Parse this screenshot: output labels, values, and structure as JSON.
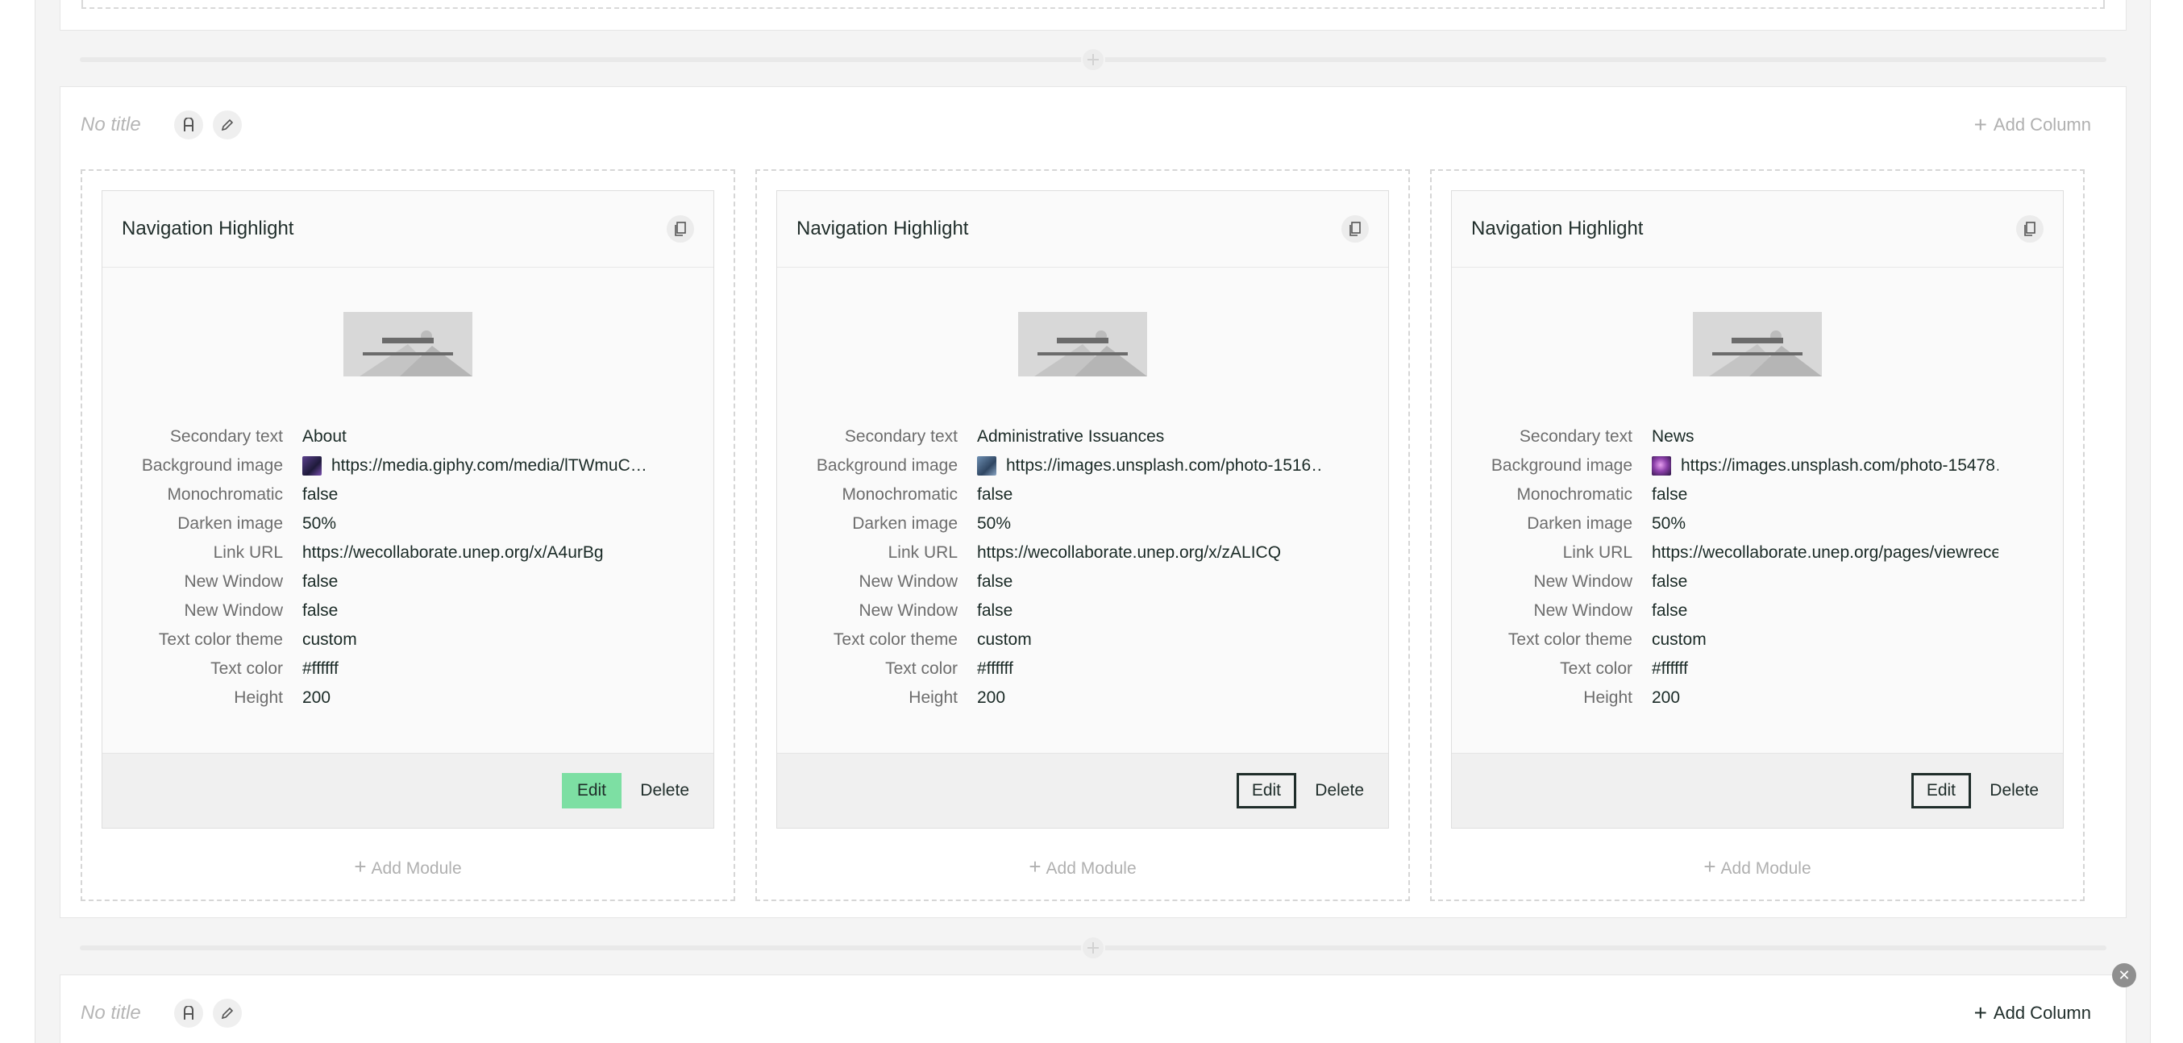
{
  "rows": [
    {
      "title": "No title",
      "add_column_label": "Add Column",
      "columns": [
        {
          "module": {
            "title": "Navigation Highlight",
            "props": [
              {
                "label": "Secondary text",
                "value": "About"
              },
              {
                "label": "Background image",
                "value": "https://media.giphy.com/media/lTWmuC…",
                "swatch": "#3b2c5e"
              },
              {
                "label": "Monochromatic",
                "value": "false"
              },
              {
                "label": "Darken image",
                "value": "50%"
              },
              {
                "label": "Link URL",
                "value": "https://wecollaborate.unep.org/x/A4urBg"
              },
              {
                "label": "New Window",
                "value": "false"
              },
              {
                "label": "New Window",
                "value": "false"
              },
              {
                "label": "Text color theme",
                "value": "custom"
              },
              {
                "label": "Text color",
                "value": "#ffffff"
              },
              {
                "label": "Height",
                "value": "200"
              }
            ],
            "edit_label": "Edit",
            "delete_label": "Delete"
          },
          "add_module_label": "Add Module"
        },
        {
          "module": {
            "title": "Navigation Highlight",
            "props": [
              {
                "label": "Secondary text",
                "value": "Administrative Issuances"
              },
              {
                "label": "Background image",
                "value": "https://images.unsplash.com/photo-1516…",
                "swatch": "#4a6a8c"
              },
              {
                "label": "Monochromatic",
                "value": "false"
              },
              {
                "label": "Darken image",
                "value": "50%"
              },
              {
                "label": "Link URL",
                "value": "https://wecollaborate.unep.org/x/zALICQ"
              },
              {
                "label": "New Window",
                "value": "false"
              },
              {
                "label": "New Window",
                "value": "false"
              },
              {
                "label": "Text color theme",
                "value": "custom"
              },
              {
                "label": "Text color",
                "value": "#ffffff"
              },
              {
                "label": "Height",
                "value": "200"
              }
            ],
            "edit_label": "Edit",
            "delete_label": "Delete"
          },
          "add_module_label": "Add Module"
        },
        {
          "module": {
            "title": "Navigation Highlight",
            "props": [
              {
                "label": "Secondary text",
                "value": "News"
              },
              {
                "label": "Background image",
                "value": "https://images.unsplash.com/photo-15478…",
                "swatch": "#8a3fa8"
              },
              {
                "label": "Monochromatic",
                "value": "false"
              },
              {
                "label": "Darken image",
                "value": "50%"
              },
              {
                "label": "Link URL",
                "value": "https://wecollaborate.unep.org/pages/viewrece…"
              },
              {
                "label": "New Window",
                "value": "false"
              },
              {
                "label": "New Window",
                "value": "false"
              },
              {
                "label": "Text color theme",
                "value": "custom"
              },
              {
                "label": "Text color",
                "value": "#ffffff"
              },
              {
                "label": "Height",
                "value": "200"
              }
            ],
            "edit_label": "Edit",
            "delete_label": "Delete"
          },
          "add_module_label": "Add Module"
        }
      ]
    },
    {
      "title": "No title",
      "add_column_label": "Add Column"
    }
  ],
  "colors": {
    "edit_hover": "#7ddfa3",
    "text_dark": "#1f2d2a",
    "muted": "#b0b0b0"
  }
}
